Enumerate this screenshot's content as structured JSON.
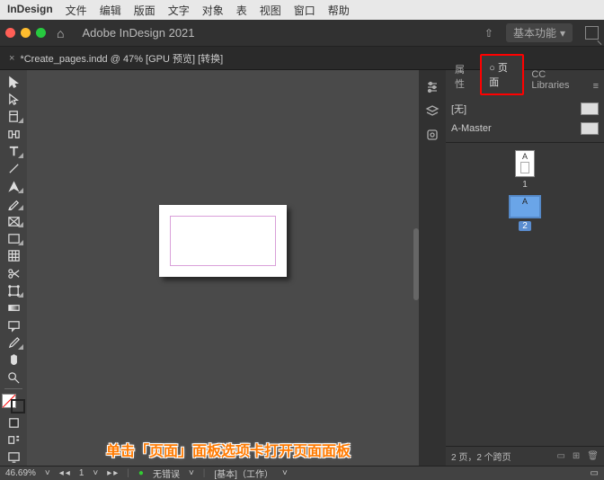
{
  "mac_menu": {
    "app": "InDesign",
    "items": [
      "文件",
      "编辑",
      "版面",
      "文字",
      "对象",
      "表",
      "视图",
      "窗口",
      "帮助"
    ]
  },
  "app_bar": {
    "title": "Adobe InDesign 2021",
    "workspace": "基本功能"
  },
  "doc_tab": {
    "name": "*Create_pages.indd @ 47% [GPU 预览] [转换]"
  },
  "panel": {
    "tabs": {
      "properties": "属性",
      "pages": "页面",
      "cc": "CC Libraries"
    },
    "masters": [
      {
        "label": "[无]"
      },
      {
        "label": "A-Master"
      }
    ],
    "pages": [
      {
        "badge": "A",
        "num": "1"
      },
      {
        "badge": "A",
        "num": "2",
        "selected": true
      }
    ],
    "footer": "2 页，2 个跨页"
  },
  "status": {
    "zoom": "46.69%",
    "field2": "1",
    "errors": "无错误",
    "work": "[基本]（工作）"
  },
  "annotation": "单击「页面」面板选项卡打开页面面板",
  "icons": {
    "selection": "selection-tool",
    "direct": "direct-select-tool",
    "page": "page-tool",
    "gap": "gap-tool",
    "type": "type-tool",
    "line": "line-tool",
    "pen": "pen-tool",
    "pencil": "pencil-tool",
    "rect_frame": "rect-frame-tool",
    "rect": "rectangle-tool",
    "grid": "grid-tool",
    "scissors": "scissors-tool",
    "transform": "free-transform-tool",
    "gradient": "gradient-swatch-tool",
    "note": "note-tool",
    "eyedrop": "eyedropper-tool",
    "hand": "hand-tool",
    "zoom": "zoom-tool"
  }
}
